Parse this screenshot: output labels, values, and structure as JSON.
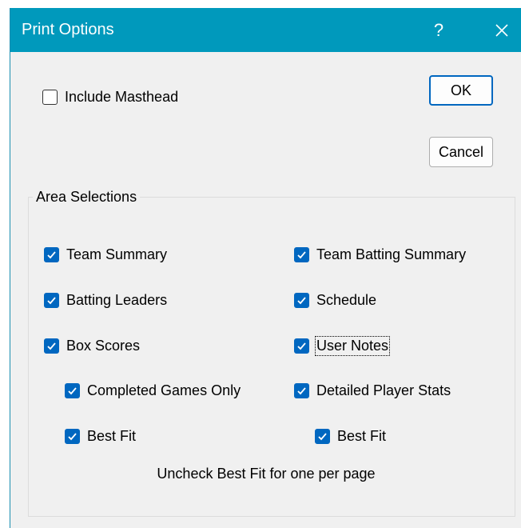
{
  "window": {
    "title": "Print Options",
    "help_label": "?",
    "close_icon": "close-icon",
    "titlebar_color": "#0099bc"
  },
  "buttons": {
    "ok_label": "OK",
    "cancel_label": "Cancel"
  },
  "masthead": {
    "label": "Include Masthead",
    "checked": false
  },
  "area": {
    "group_label": "Area Selections",
    "hint": "Uncheck Best Fit for one per page",
    "left_column": [
      {
        "label": "Team Summary",
        "checked": true
      },
      {
        "label": "Batting Leaders",
        "checked": true
      },
      {
        "label": "Box Scores",
        "checked": true
      },
      {
        "label": "Completed Games Only",
        "checked": true
      },
      {
        "label": "Best Fit",
        "checked": true
      }
    ],
    "right_column": [
      {
        "label": "Team Batting Summary",
        "checked": true
      },
      {
        "label": "Schedule",
        "checked": true
      },
      {
        "label": "User Notes",
        "checked": true
      },
      {
        "label": "Detailed Player Stats",
        "checked": true
      },
      {
        "label": "Best Fit",
        "checked": true
      }
    ]
  },
  "colors": {
    "accent": "#0067c0"
  }
}
